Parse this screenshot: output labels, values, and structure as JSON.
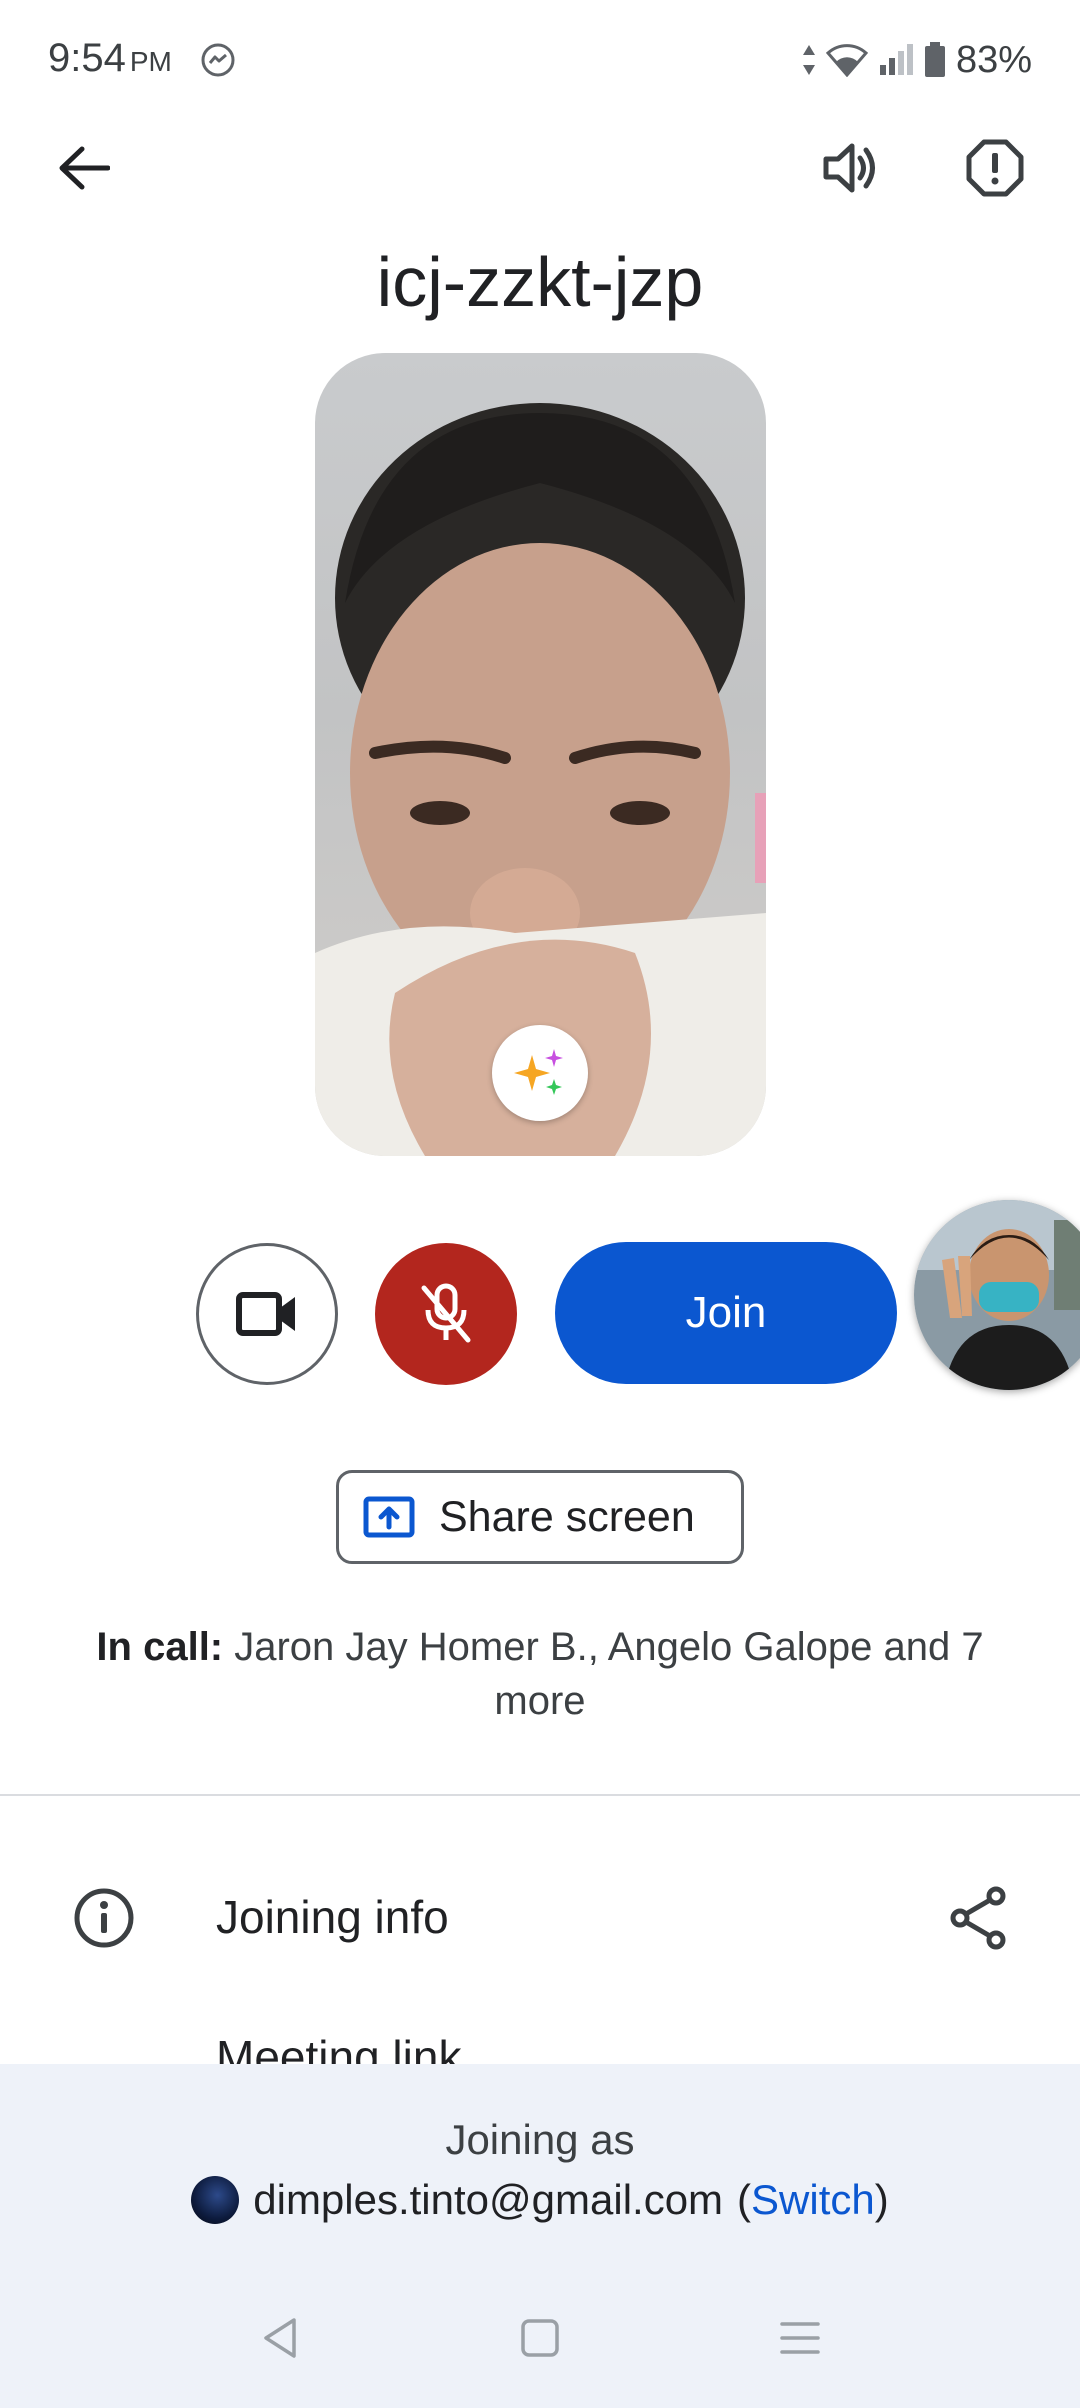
{
  "status_bar": {
    "time": "9:54",
    "ampm": "PM",
    "battery": "83%"
  },
  "meeting": {
    "code": "icj-zzkt-jzp"
  },
  "controls": {
    "join_label": "Join",
    "share_label": "Share screen"
  },
  "in_call": {
    "prefix": "In call:",
    "participants": " Jaron Jay Homer B., Angelo Galope and 7 more"
  },
  "info": {
    "joining_info_label": "Joining info",
    "meeting_link_label": "Meeting link"
  },
  "joining_as": {
    "label": "Joining as",
    "email": "dimples.tinto@gmail.com",
    "open_paren": "(",
    "switch_label": "Switch",
    "close_paren": ")"
  },
  "colors": {
    "join_blue": "#0b57d0",
    "mic_off_red": "#b3261e",
    "sheet_bg": "#eef2f9"
  }
}
